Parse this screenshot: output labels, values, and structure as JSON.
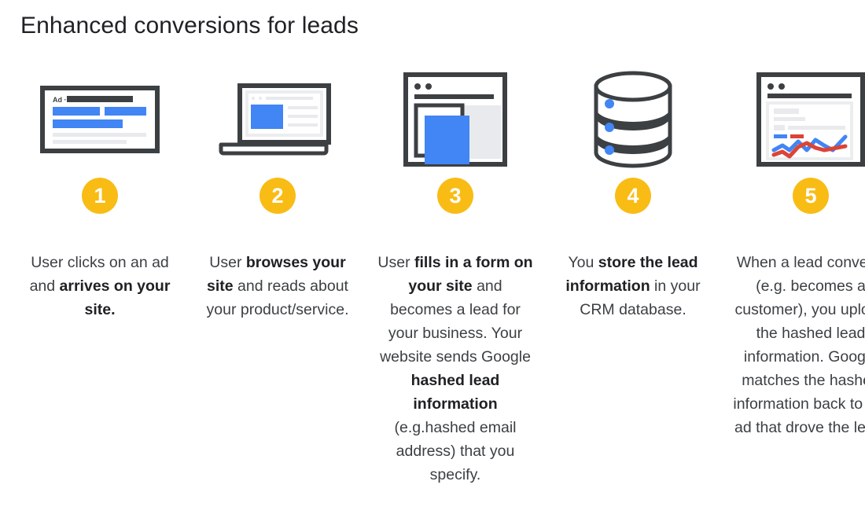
{
  "header": {
    "title": "Enhanced conversions for leads"
  },
  "colors": {
    "badge": "#F9BC15",
    "accent_blue": "#4285F4",
    "accent_red": "#DB4437",
    "outline_dark": "#3C4043",
    "light_gray": "#E8EAED",
    "text": "#3C4043",
    "text_strong": "#202124"
  },
  "steps": [
    {
      "number": "1",
      "icon": "search-ad-result-icon",
      "icon_label": "Ad ·",
      "text_html": "User clicks on an ad and <b>arrives on your site.</b>",
      "text_plain": "User clicks on an ad and arrives on your site."
    },
    {
      "number": "2",
      "icon": "laptop-browsing-icon",
      "text_html": "User <b>browses your site</b> and reads about your product/service.",
      "text_plain": "User browses your site and reads about your product/service."
    },
    {
      "number": "3",
      "icon": "form-submission-window-icon",
      "text_html": "User <b>fills in a form on your site</b> and becomes a lead for your business. Your website sends Google <b>hashed lead information</b> (e.g.hashed email address) that you specify.",
      "text_plain": "User fills in a form on your site and becomes a lead for your business. Your website sends Google hashed lead information (e.g.hashed email address) that you specify."
    },
    {
      "number": "4",
      "icon": "database-icon",
      "text_html": "You <b>store the lead information</b> in your CRM database.",
      "text_plain": "You store the lead information in your CRM database."
    },
    {
      "number": "5",
      "icon": "analytics-chart-window-icon",
      "text_html": "When a lead converts (e.g. becomes a customer), you upload the hashed lead information. Google matches the hashed information back to the ad that drove the lead.",
      "text_plain": "When a lead converts (e.g. becomes a customer), you upload the hashed lead information. Google matches the hashed information back to the ad that drove the lead."
    }
  ]
}
